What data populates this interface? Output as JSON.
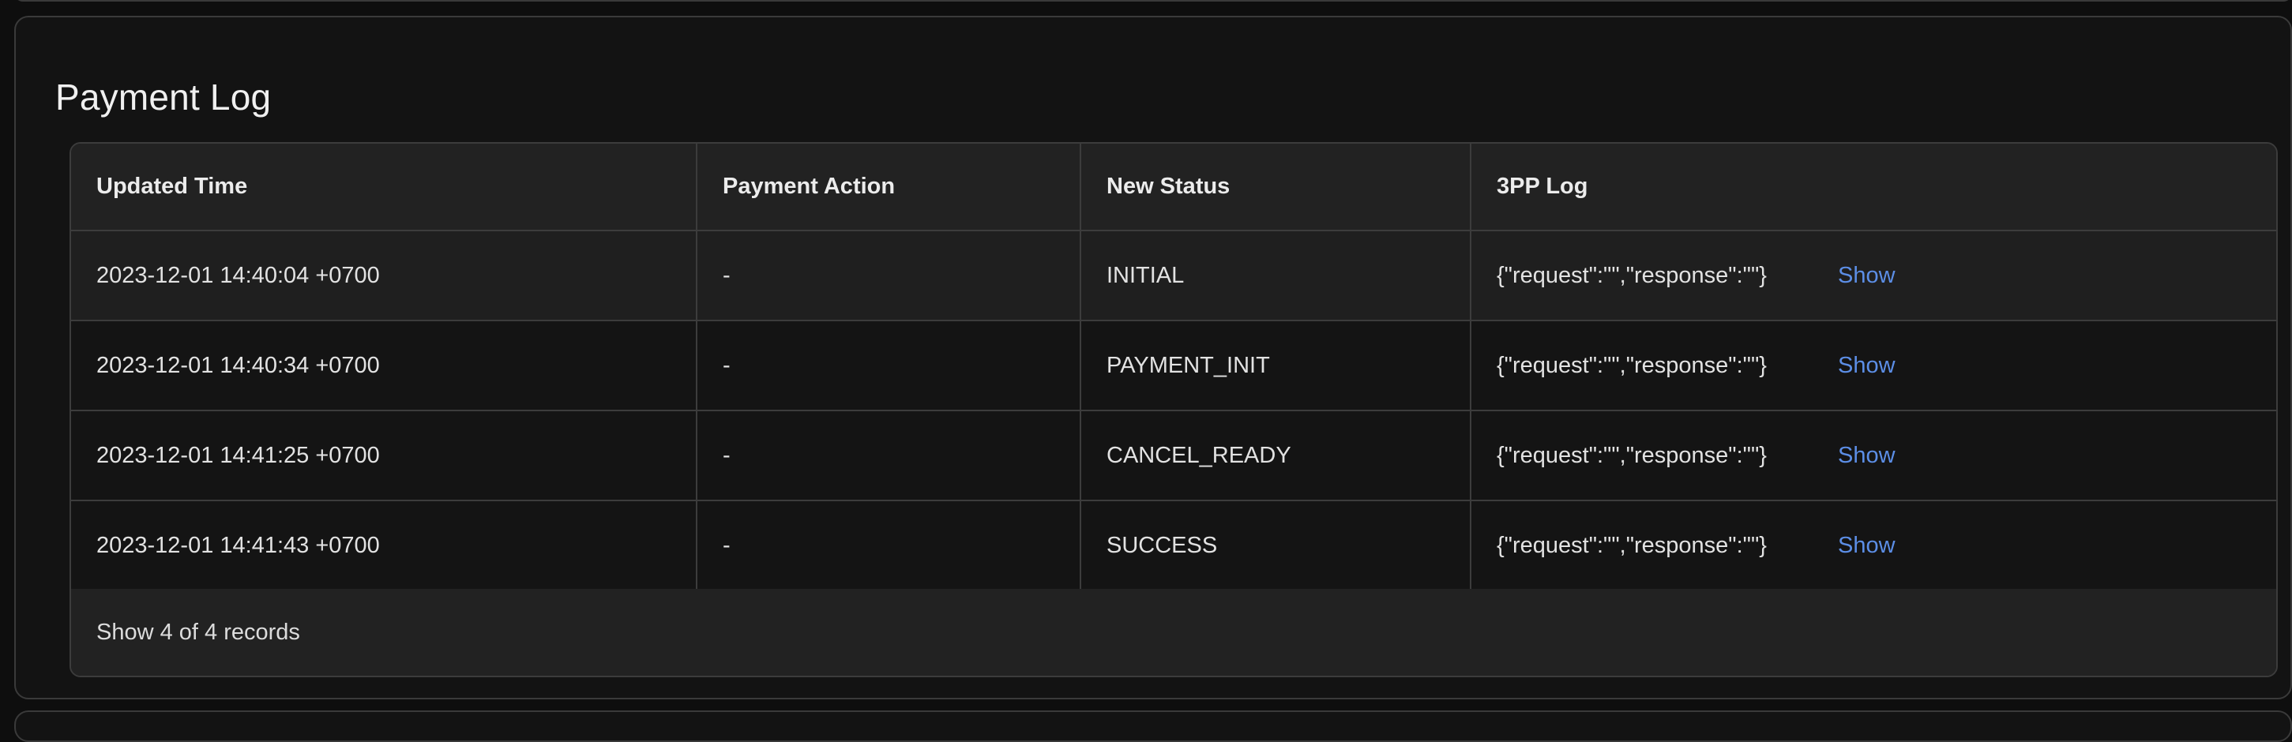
{
  "section": {
    "title": "Payment Log"
  },
  "table": {
    "columns": [
      "Updated Time",
      "Payment Action",
      "New Status",
      "3PP Log"
    ],
    "rows": [
      {
        "updated_time": "2023-12-01 14:40:04 +0700",
        "payment_action": "-",
        "new_status": "INITIAL",
        "log": "{\"request\":\"\",\"response\":\"\"}",
        "action_label": "Show"
      },
      {
        "updated_time": "2023-12-01 14:40:34 +0700",
        "payment_action": "-",
        "new_status": "PAYMENT_INIT",
        "log": "{\"request\":\"\",\"response\":\"\"}",
        "action_label": "Show"
      },
      {
        "updated_time": "2023-12-01 14:41:25 +0700",
        "payment_action": "-",
        "new_status": "CANCEL_READY",
        "log": "{\"request\":\"\",\"response\":\"\"}",
        "action_label": "Show"
      },
      {
        "updated_time": "2023-12-01 14:41:43 +0700",
        "payment_action": "-",
        "new_status": "SUCCESS",
        "log": "{\"request\":\"\",\"response\":\"\"}",
        "action_label": "Show"
      }
    ],
    "footer": "Show 4 of 4 records"
  },
  "colors": {
    "link": "#5c8ee6",
    "background": "#131313",
    "border": "#3c3c3c"
  }
}
